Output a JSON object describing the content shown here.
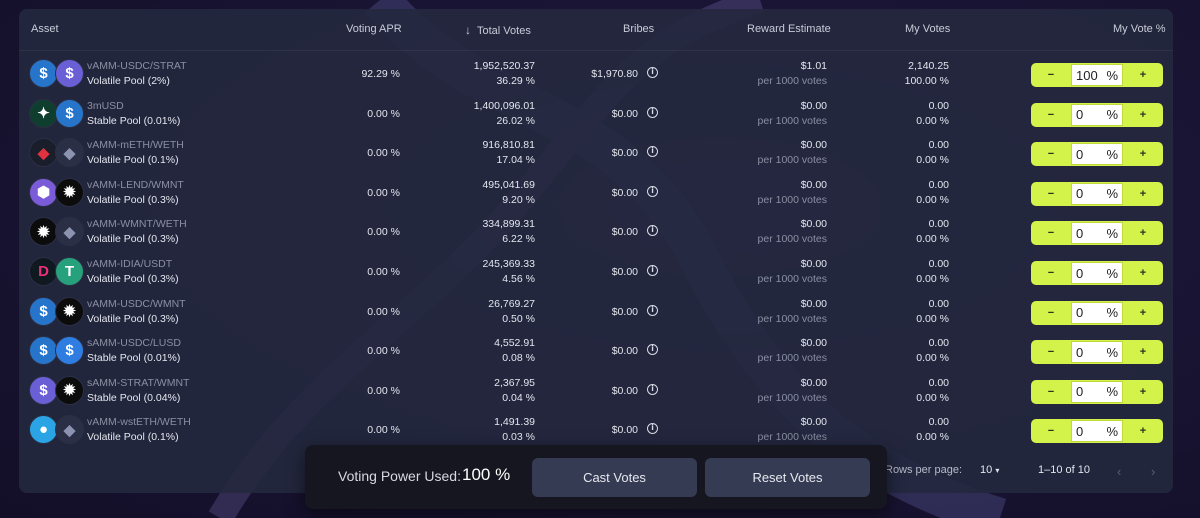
{
  "colors": {
    "accent": "#d4f34a",
    "panel": "#24283e",
    "button": "#353b52"
  },
  "table": {
    "headers": {
      "asset": "Asset",
      "voting_apr": "Voting APR",
      "total_votes": "Total Votes",
      "bribes": "Bribes",
      "reward_estimate": "Reward Estimate",
      "my_votes": "My Votes",
      "my_vote_pct": "My Vote %"
    },
    "sort_icon": "arrow-down-icon",
    "rows": [
      {
        "name": "vAMM-USDC/STRAT",
        "pool": "Volatile Pool (2%)",
        "apr": "92.29 %",
        "total_votes": "1,952,520.37",
        "total_pct": "36.29 %",
        "bribes": "$1,970.80",
        "reward": "$1.01",
        "reward_sub": "per 1000 votes",
        "my_votes": "2,140.25",
        "my_votes_pct": "100.00 %",
        "vote_value": "100",
        "icons": [
          "usdc-icon",
          "strat-icon"
        ]
      },
      {
        "name": "3mUSD",
        "pool": "Stable Pool (0.01%)",
        "apr": "0.00 %",
        "total_votes": "1,400,096.01",
        "total_pct": "26.02 %",
        "bribes": "$0.00",
        "reward": "$0.00",
        "reward_sub": "per 1000 votes",
        "my_votes": "0.00",
        "my_votes_pct": "0.00 %",
        "vote_value": "0",
        "icons": [
          "mnt-icon",
          "usdc-icon"
        ]
      },
      {
        "name": "vAMM-mETH/WETH",
        "pool": "Volatile Pool (0.1%)",
        "apr": "0.00 %",
        "total_votes": "916,810.81",
        "total_pct": "17.04 %",
        "bribes": "$0.00",
        "reward": "$0.00",
        "reward_sub": "per 1000 votes",
        "my_votes": "0.00",
        "my_votes_pct": "0.00 %",
        "vote_value": "0",
        "icons": [
          "meth-icon",
          "weth-icon"
        ]
      },
      {
        "name": "vAMM-LEND/WMNT",
        "pool": "Volatile Pool (0.3%)",
        "apr": "0.00 %",
        "total_votes": "495,041.69",
        "total_pct": "9.20 %",
        "bribes": "$0.00",
        "reward": "$0.00",
        "reward_sub": "per 1000 votes",
        "my_votes": "0.00",
        "my_votes_pct": "0.00 %",
        "vote_value": "0",
        "icons": [
          "lend-icon",
          "wmnt-icon"
        ]
      },
      {
        "name": "vAMM-WMNT/WETH",
        "pool": "Volatile Pool (0.3%)",
        "apr": "0.00 %",
        "total_votes": "334,899.31",
        "total_pct": "6.22 %",
        "bribes": "$0.00",
        "reward": "$0.00",
        "reward_sub": "per 1000 votes",
        "my_votes": "0.00",
        "my_votes_pct": "0.00 %",
        "vote_value": "0",
        "icons": [
          "wmnt-icon",
          "weth-icon"
        ]
      },
      {
        "name": "vAMM-IDIA/USDT",
        "pool": "Volatile Pool (0.3%)",
        "apr": "0.00 %",
        "total_votes": "245,369.33",
        "total_pct": "4.56 %",
        "bribes": "$0.00",
        "reward": "$0.00",
        "reward_sub": "per 1000 votes",
        "my_votes": "0.00",
        "my_votes_pct": "0.00 %",
        "vote_value": "0",
        "icons": [
          "idia-icon",
          "usdt-icon"
        ]
      },
      {
        "name": "vAMM-USDC/WMNT",
        "pool": "Volatile Pool (0.3%)",
        "apr": "0.00 %",
        "total_votes": "26,769.27",
        "total_pct": "0.50 %",
        "bribes": "$0.00",
        "reward": "$0.00",
        "reward_sub": "per 1000 votes",
        "my_votes": "0.00",
        "my_votes_pct": "0.00 %",
        "vote_value": "0",
        "icons": [
          "usdc-icon",
          "wmnt-icon"
        ]
      },
      {
        "name": "sAMM-USDC/LUSD",
        "pool": "Stable Pool (0.01%)",
        "apr": "0.00 %",
        "total_votes": "4,552.91",
        "total_pct": "0.08 %",
        "bribes": "$0.00",
        "reward": "$0.00",
        "reward_sub": "per 1000 votes",
        "my_votes": "0.00",
        "my_votes_pct": "0.00 %",
        "vote_value": "0",
        "icons": [
          "usdc-icon",
          "lusd-icon"
        ]
      },
      {
        "name": "sAMM-STRAT/WMNT",
        "pool": "Stable Pool (0.04%)",
        "apr": "0.00 %",
        "total_votes": "2,367.95",
        "total_pct": "0.04 %",
        "bribes": "$0.00",
        "reward": "$0.00",
        "reward_sub": "per 1000 votes",
        "my_votes": "0.00",
        "my_votes_pct": "0.00 %",
        "vote_value": "0",
        "icons": [
          "strat-icon",
          "wmnt-icon"
        ]
      },
      {
        "name": "vAMM-wstETH/WETH",
        "pool": "Volatile Pool (0.1%)",
        "apr": "0.00 %",
        "total_votes": "1,491.39",
        "total_pct": "0.03 %",
        "bribes": "$0.00",
        "reward": "$0.00",
        "reward_sub": "per 1000 votes",
        "my_votes": "0.00",
        "my_votes_pct": "0.00 %",
        "vote_value": "0",
        "icons": [
          "wsteth-icon",
          "weth-icon"
        ]
      }
    ],
    "stepper": {
      "minus": "−",
      "plus": "+",
      "unit": "%"
    }
  },
  "pagination": {
    "rows_label": "Rows per page:",
    "rows_value": "10",
    "range": "1–10 of 10",
    "prev_icon": "chevron-left-icon",
    "next_icon": "chevron-right-icon"
  },
  "vote_bar": {
    "label": "Voting Power Used:",
    "value": "100 %",
    "cast_label": "Cast Votes",
    "reset_label": "Reset Votes"
  }
}
